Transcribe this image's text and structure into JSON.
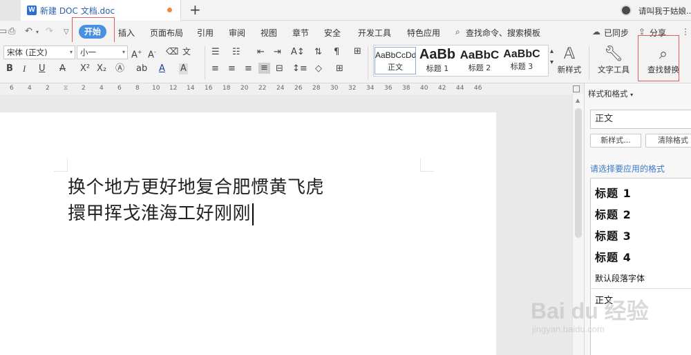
{
  "titlebar": {
    "doc_tab": "新建 DOC 文档.doc",
    "add_tab": "+",
    "user_name": "请叫我于姑娘..."
  },
  "menu": {
    "items": [
      "开始",
      "插入",
      "页面布局",
      "引用",
      "审阅",
      "视图",
      "章节",
      "安全",
      "开发工具",
      "特色应用"
    ],
    "search": "查找命令、搜索模板",
    "sync": "已同步",
    "share": "分享"
  },
  "ribbon": {
    "font_name": "宋体 (正文)",
    "font_size": "小一",
    "styles": [
      {
        "preview": "AaBbCcDd",
        "label": "正文"
      },
      {
        "preview": "AaBb",
        "label": "标题 1"
      },
      {
        "preview": "AaBbC",
        "label": "标题 2"
      },
      {
        "preview": "AaBbC",
        "label": "标题 3"
      }
    ],
    "new_style": "新样式",
    "text_tools": "文字工具",
    "find_replace": "查找替换"
  },
  "ruler": {
    "ticks": [
      "6",
      "4",
      "2",
      "2",
      "4",
      "6",
      "8",
      "10",
      "12",
      "14",
      "16",
      "18",
      "20",
      "22",
      "24",
      "26",
      "28",
      "30",
      "32",
      "34",
      "36",
      "38",
      "40",
      "42",
      "44",
      "46"
    ]
  },
  "document": {
    "lines": [
      "换个地方更好地复合肥惯黄飞虎",
      "擐甲挥戈淮海工好刚刚"
    ]
  },
  "side_panel": {
    "title": "样式和格式",
    "current_style": "正文",
    "new_style_btn": "新样式...",
    "clear_format_btn": "清除格式",
    "hint": "请选择要应用的格式",
    "styles": [
      "标题 1",
      "标题 2",
      "标题 3",
      "标题 4",
      "默认段落字体",
      "正文"
    ]
  },
  "watermark": {
    "main": "Bai du 经验",
    "sub": "jingyan.baidu.com"
  },
  "colors": {
    "accent": "#4a90e2",
    "highlight_box": "#e05a5a",
    "hint_text": "#3a78c9"
  }
}
